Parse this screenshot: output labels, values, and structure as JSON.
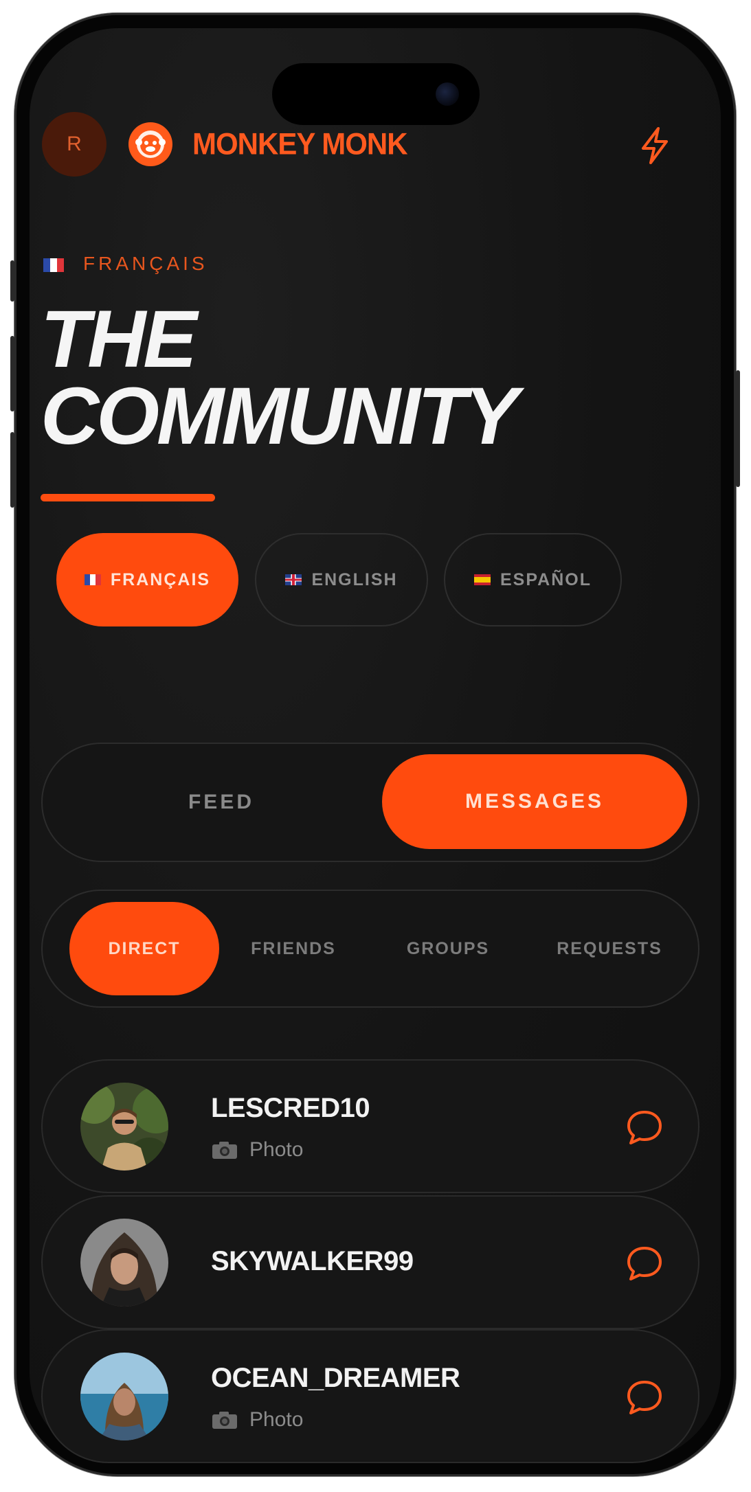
{
  "header": {
    "avatar_initial": "R",
    "brand": "MONKEY MONK"
  },
  "language_label": "FRANÇAIS",
  "title": {
    "line1": "THE",
    "line2": "COMMUNITY"
  },
  "languages": [
    {
      "label": "FRANÇAIS",
      "flag": "fr",
      "active": true
    },
    {
      "label": "ENGLISH",
      "flag": "gb",
      "active": false
    },
    {
      "label": "ESPAÑOL",
      "flag": "es",
      "active": false
    }
  ],
  "segment": {
    "feed": "FEED",
    "messages": "MESSAGES",
    "active": "messages"
  },
  "subtabs": [
    {
      "label": "DIRECT",
      "active": true
    },
    {
      "label": "FRIENDS",
      "active": false
    },
    {
      "label": "GROUPS",
      "active": false
    },
    {
      "label": "REQUESTS",
      "active": false
    }
  ],
  "conversations": [
    {
      "name": "LESCRED10",
      "preview": "Photo",
      "has_preview": true,
      "icon": "chat-bubble-icon"
    },
    {
      "name": "SKYWALKER99",
      "preview": "",
      "has_preview": false,
      "icon": "chat-bubble-icon"
    },
    {
      "name": "OCEAN_DREAMER",
      "preview": "Photo",
      "has_preview": true,
      "icon": "chat-bubble-icon"
    }
  ],
  "colors": {
    "accent": "#ff4b0e",
    "background": "#141414",
    "text": "#f5f5f5",
    "muted": "#8a8a8a"
  }
}
